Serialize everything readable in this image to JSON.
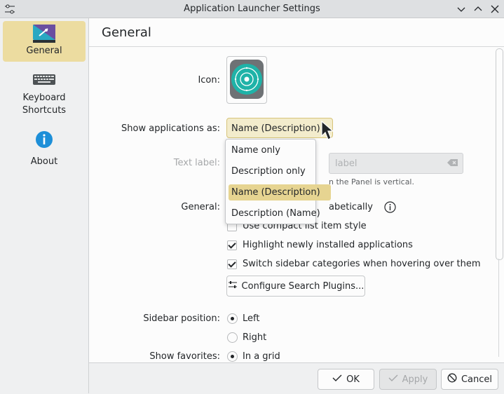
{
  "window": {
    "title": "Application Launcher Settings"
  },
  "sidebar": {
    "items": [
      {
        "label": "General",
        "icon": "general-settings-icon",
        "selected": true
      },
      {
        "label": "Keyboard\nShortcuts",
        "icon": "keyboard-icon",
        "selected": false
      },
      {
        "label": "About",
        "icon": "info-icon",
        "selected": false
      }
    ]
  },
  "page": {
    "title": "General"
  },
  "form": {
    "icon_label": "Icon:",
    "show_apps_label": "Show applications as:",
    "show_apps_value": "Name (Description)",
    "text_label": "Text label:",
    "text_label_placeholder": "label",
    "text_hint": "n the Panel is vertical.",
    "general_label": "General:",
    "general_partial": "abetically",
    "opt_compact": "Use compact list item style",
    "opt_highlight": "Highlight newly installed applications",
    "opt_switch": "Switch sidebar categories when hovering over them",
    "configure_plugins": "Configure Search Plugins...",
    "sidebar_pos_label": "Sidebar position:",
    "sidebar_left": "Left",
    "sidebar_right": "Right",
    "show_fav_label": "Show favorites:",
    "fav_grid": "In a grid"
  },
  "dropdown": {
    "options": [
      "Name only",
      "Description only",
      "Name (Description)",
      "Description (Name)"
    ],
    "selected": "Name (Description)"
  },
  "buttons": {
    "ok": "OK",
    "apply": "Apply",
    "cancel": "Cancel"
  },
  "colors": {
    "accent_selected": "#ecdca0",
    "combo_bg": "#f3eccc",
    "highlight": "#e6d491"
  }
}
